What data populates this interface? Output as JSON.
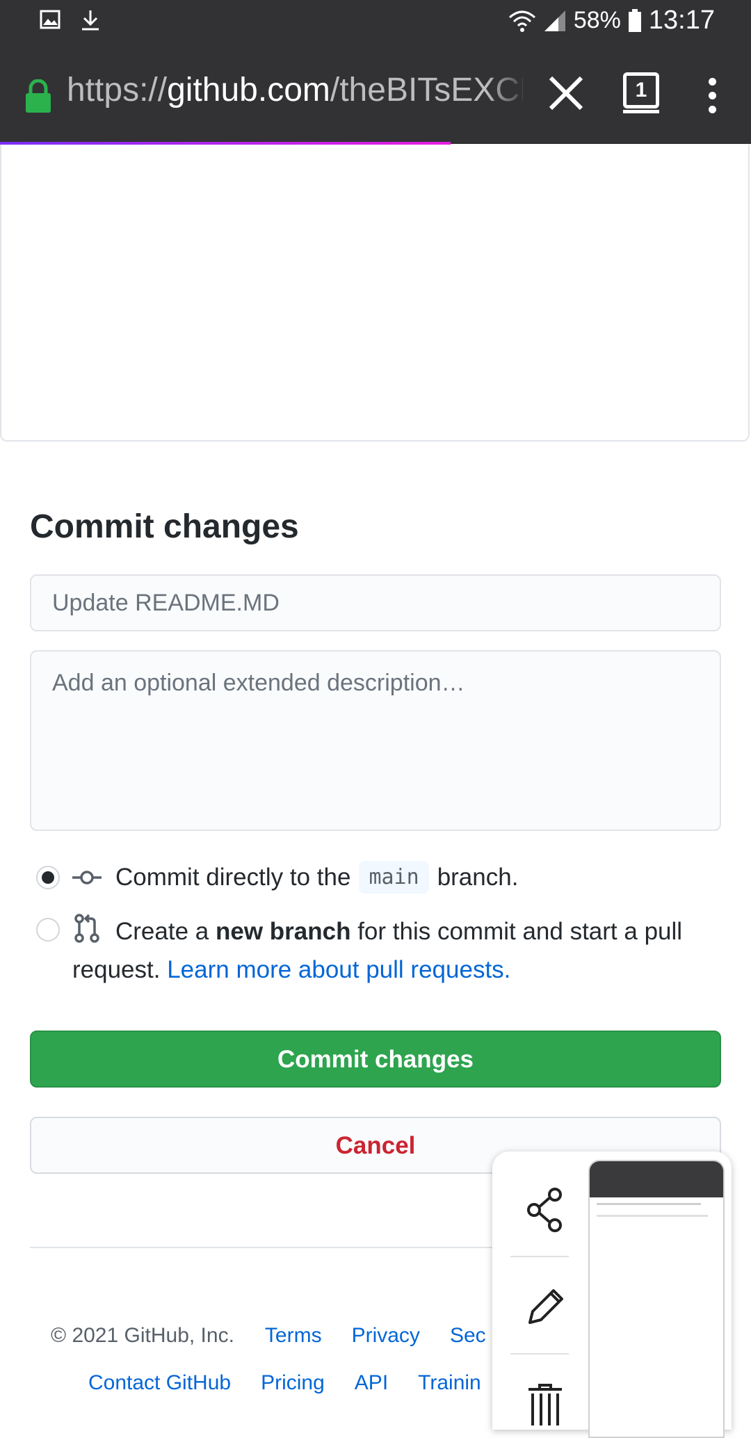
{
  "status_bar": {
    "battery_percent": "58%",
    "time": "13:17"
  },
  "browser": {
    "url_scheme": "https://",
    "url_host": "github.com",
    "url_path": "/theBITsEXCHANGE",
    "tab_count": "1"
  },
  "commit": {
    "heading": "Commit changes",
    "summary_placeholder": "Update README.MD",
    "description_placeholder": "Add an optional extended description…",
    "option_direct": {
      "prefix": "Commit directly to the",
      "branch": "main",
      "suffix": "branch."
    },
    "option_new_branch": {
      "prefix": "Create a",
      "bold": "new branch",
      "rest": "for this commit and start a pull request.",
      "link": "Learn more about pull requests."
    },
    "commit_button": "Commit changes",
    "cancel_button": "Cancel"
  },
  "footer": {
    "copyright": "© 2021 GitHub, Inc.",
    "row1_links": [
      "Terms",
      "Privacy",
      "Sec"
    ],
    "row2_links": [
      "Contact GitHub",
      "Pricing",
      "API",
      "Trainin"
    ]
  },
  "colors": {
    "primary_green": "#2ea44f",
    "danger_red": "#cb2431",
    "link_blue": "#0366d6"
  },
  "icons": [
    "image-icon",
    "download-icon",
    "wifi-icon",
    "signal-icon",
    "battery-icon",
    "lock-icon",
    "close-icon",
    "tabs-icon",
    "overflow-menu-icon",
    "commit-icon",
    "pull-request-icon",
    "share-icon",
    "edit-icon",
    "delete-icon"
  ]
}
